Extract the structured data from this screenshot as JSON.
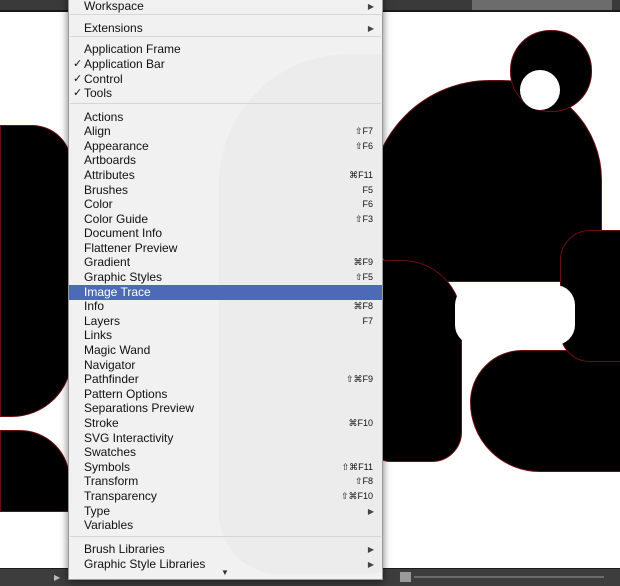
{
  "menu": {
    "items": [
      {
        "label": "Workspace",
        "checked": false,
        "shortcut": "",
        "submenu": true,
        "highlight": false
      },
      {
        "label": "Extensions",
        "checked": false,
        "shortcut": "",
        "submenu": true,
        "highlight": false
      },
      {
        "label": "Application Frame",
        "checked": false,
        "shortcut": "",
        "submenu": false,
        "highlight": false
      },
      {
        "label": "Application Bar",
        "checked": true,
        "shortcut": "",
        "submenu": false,
        "highlight": false
      },
      {
        "label": "Control",
        "checked": true,
        "shortcut": "",
        "submenu": false,
        "highlight": false
      },
      {
        "label": "Tools",
        "checked": true,
        "shortcut": "",
        "submenu": false,
        "highlight": false
      },
      {
        "label": "Actions",
        "checked": false,
        "shortcut": "",
        "submenu": false,
        "highlight": false
      },
      {
        "label": "Align",
        "checked": false,
        "shortcut": "⇧F7",
        "submenu": false,
        "highlight": false
      },
      {
        "label": "Appearance",
        "checked": false,
        "shortcut": "⇧F6",
        "submenu": false,
        "highlight": false
      },
      {
        "label": "Artboards",
        "checked": false,
        "shortcut": "",
        "submenu": false,
        "highlight": false
      },
      {
        "label": "Attributes",
        "checked": false,
        "shortcut": "⌘F11",
        "submenu": false,
        "highlight": false
      },
      {
        "label": "Brushes",
        "checked": false,
        "shortcut": "F5",
        "submenu": false,
        "highlight": false
      },
      {
        "label": "Color",
        "checked": false,
        "shortcut": "F6",
        "submenu": false,
        "highlight": false
      },
      {
        "label": "Color Guide",
        "checked": false,
        "shortcut": "⇧F3",
        "submenu": false,
        "highlight": false
      },
      {
        "label": "Document Info",
        "checked": false,
        "shortcut": "",
        "submenu": false,
        "highlight": false
      },
      {
        "label": "Flattener Preview",
        "checked": false,
        "shortcut": "",
        "submenu": false,
        "highlight": false
      },
      {
        "label": "Gradient",
        "checked": false,
        "shortcut": "⌘F9",
        "submenu": false,
        "highlight": false
      },
      {
        "label": "Graphic Styles",
        "checked": false,
        "shortcut": "⇧F5",
        "submenu": false,
        "highlight": false
      },
      {
        "label": "Image Trace",
        "checked": false,
        "shortcut": "",
        "submenu": false,
        "highlight": true
      },
      {
        "label": "Info",
        "checked": false,
        "shortcut": "⌘F8",
        "submenu": false,
        "highlight": false
      },
      {
        "label": "Layers",
        "checked": false,
        "shortcut": "F7",
        "submenu": false,
        "highlight": false
      },
      {
        "label": "Links",
        "checked": false,
        "shortcut": "",
        "submenu": false,
        "highlight": false
      },
      {
        "label": "Magic Wand",
        "checked": false,
        "shortcut": "",
        "submenu": false,
        "highlight": false
      },
      {
        "label": "Navigator",
        "checked": false,
        "shortcut": "",
        "submenu": false,
        "highlight": false
      },
      {
        "label": "Pathfinder",
        "checked": false,
        "shortcut": "⇧⌘F9",
        "submenu": false,
        "highlight": false
      },
      {
        "label": "Pattern Options",
        "checked": false,
        "shortcut": "",
        "submenu": false,
        "highlight": false
      },
      {
        "label": "Separations Preview",
        "checked": false,
        "shortcut": "",
        "submenu": false,
        "highlight": false
      },
      {
        "label": "Stroke",
        "checked": false,
        "shortcut": "⌘F10",
        "submenu": false,
        "highlight": false
      },
      {
        "label": "SVG Interactivity",
        "checked": false,
        "shortcut": "",
        "submenu": false,
        "highlight": false
      },
      {
        "label": "Swatches",
        "checked": false,
        "shortcut": "",
        "submenu": false,
        "highlight": false
      },
      {
        "label": "Symbols",
        "checked": false,
        "shortcut": "⇧⌘F11",
        "submenu": false,
        "highlight": false
      },
      {
        "label": "Transform",
        "checked": false,
        "shortcut": "⇧F8",
        "submenu": false,
        "highlight": false
      },
      {
        "label": "Transparency",
        "checked": false,
        "shortcut": "⇧⌘F10",
        "submenu": false,
        "highlight": false
      },
      {
        "label": "Type",
        "checked": false,
        "shortcut": "",
        "submenu": true,
        "highlight": false
      },
      {
        "label": "Variables",
        "checked": false,
        "shortcut": "",
        "submenu": false,
        "highlight": false
      },
      {
        "label": "Brush Libraries",
        "checked": false,
        "shortcut": "",
        "submenu": true,
        "highlight": false
      },
      {
        "label": "Graphic Style Libraries",
        "checked": false,
        "shortcut": "",
        "submenu": true,
        "highlight": false
      }
    ],
    "check_mark": "✓",
    "submenu_arrow": "▶",
    "scroll_down_arrow": "▼"
  },
  "statusbar": {
    "nav_arrow": "▶"
  },
  "colors": {
    "highlight": "#4d6ab8",
    "menu_bg": "#f1f1f1",
    "artwork": "#000000",
    "outline": "#6b0f0f"
  }
}
